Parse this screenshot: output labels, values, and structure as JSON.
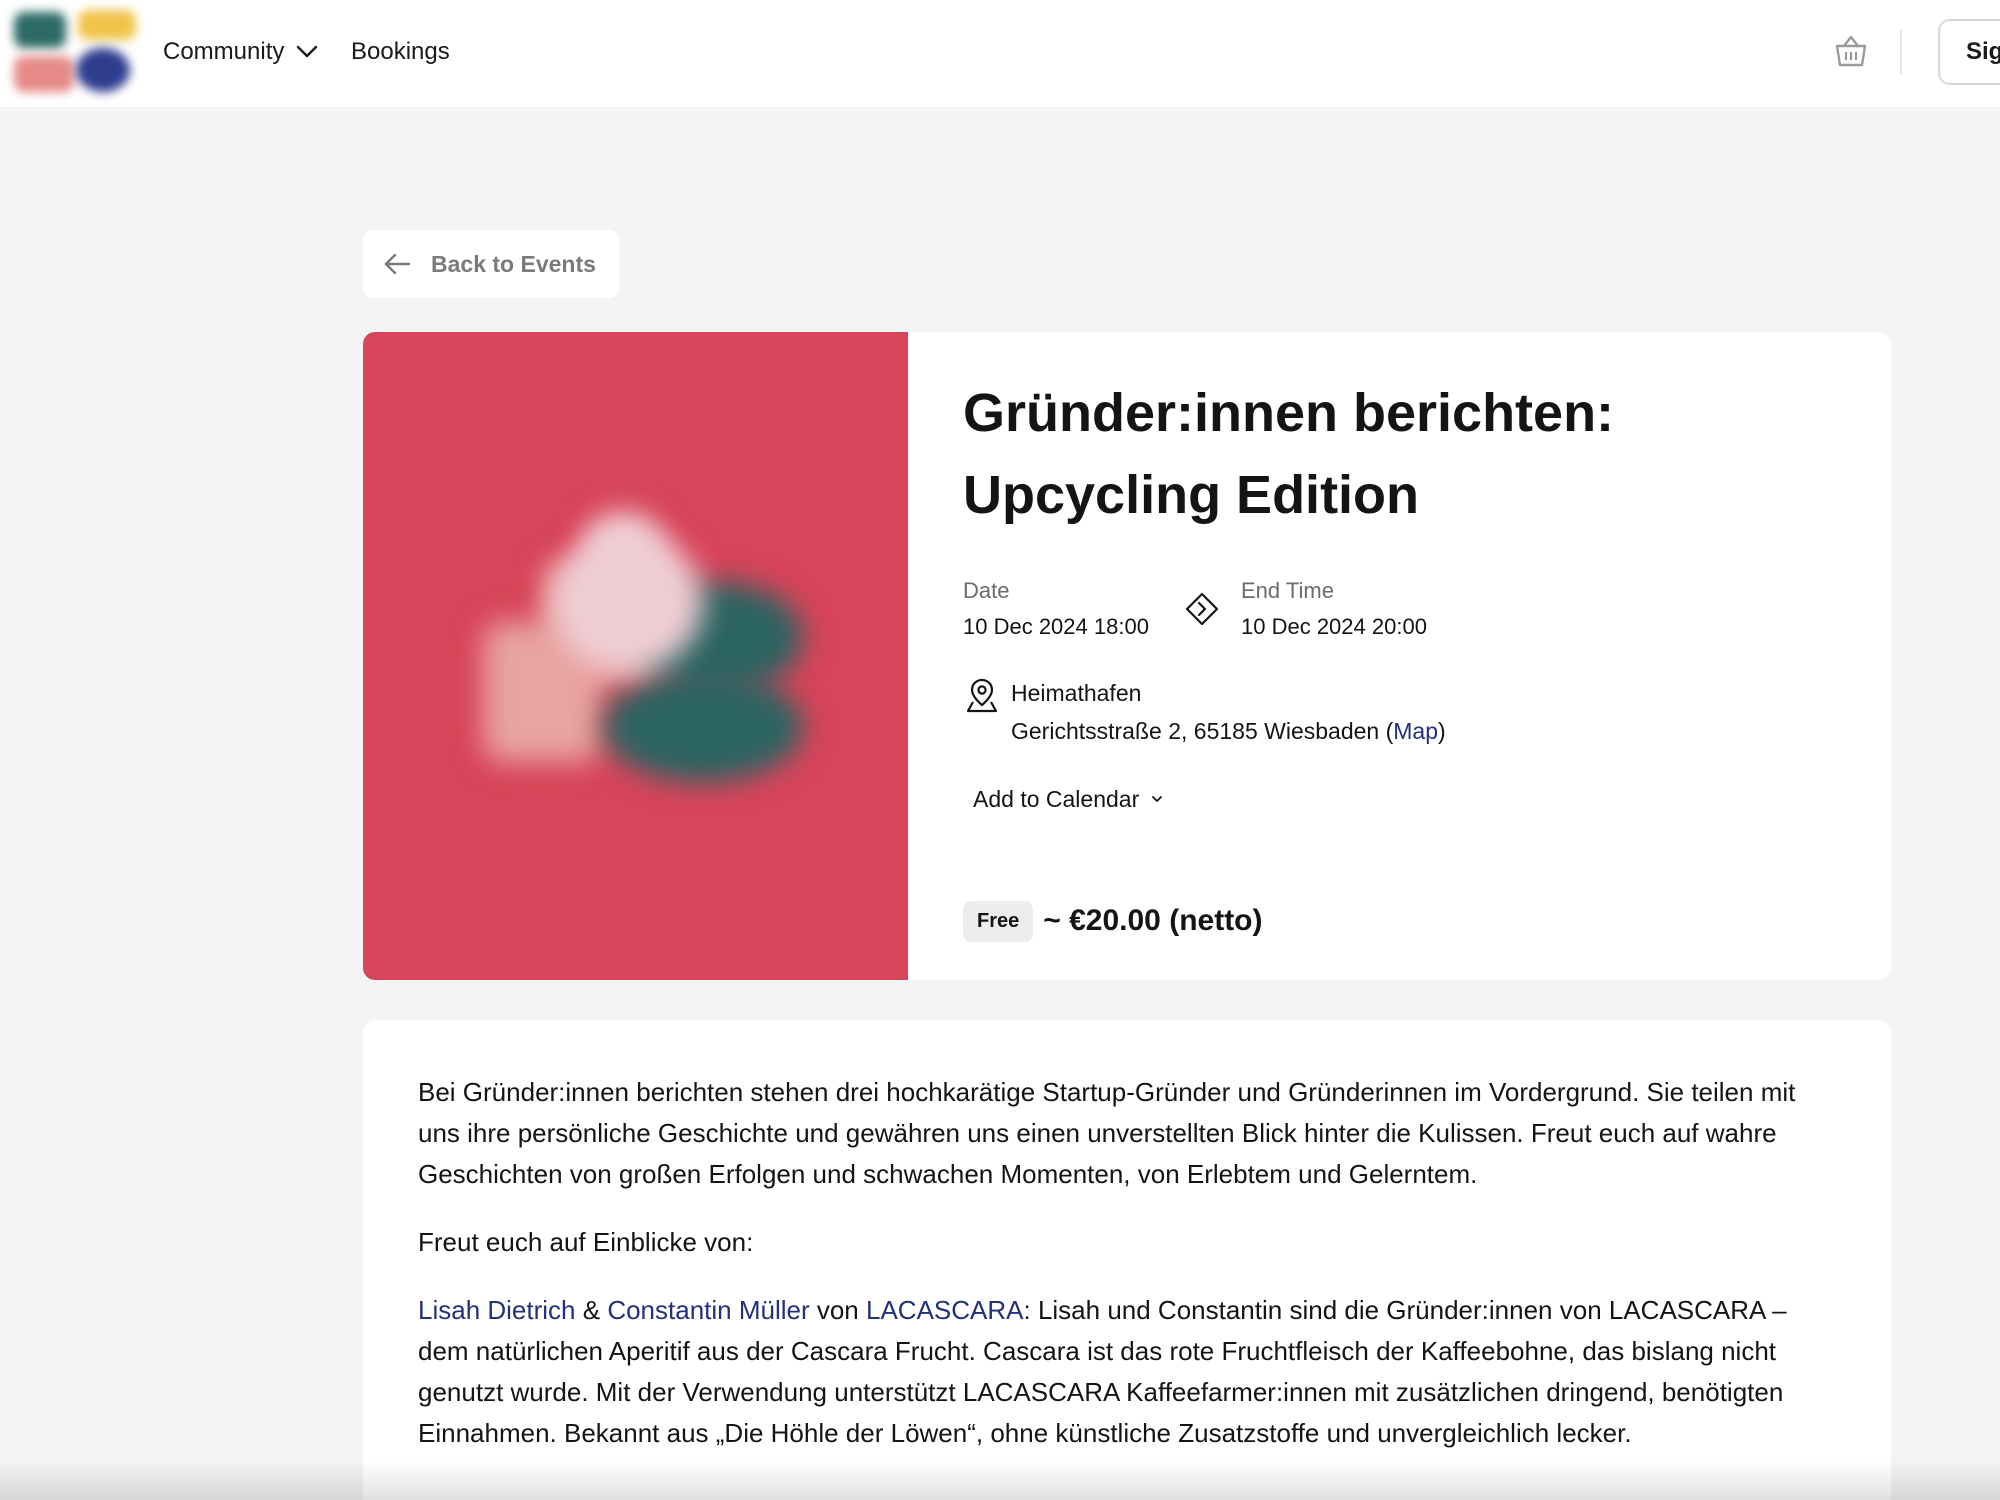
{
  "header": {
    "nav_community": "Community",
    "nav_bookings": "Bookings",
    "signin_label": "Sig",
    "logo_name": "logo",
    "cart_icon": "basket-icon",
    "chevron_icon": "chevron-down-icon"
  },
  "back_button": {
    "label": "Back to Events",
    "icon": "arrow-left-icon"
  },
  "event": {
    "title_line1": "Gründer:innen berichten:",
    "title_line2": "Upcycling Edition",
    "date_label": "Date",
    "date_value": "10 Dec 2024 18:00",
    "end_label": "End Time",
    "end_value": "10 Dec 2024 20:00",
    "arrow_icon": "arrow-right-circle-icon",
    "venue_icon": "location-pin-icon",
    "venue_name": "Heimathafen",
    "venue_address": "Gerichtsstraße 2, 65185 Wiesbaden (",
    "map_link": "Map",
    "map_close": ")",
    "add_calendar": "Add to Calendar",
    "free_badge": "Free",
    "price": "~ €20.00 (netto)",
    "image_bg_color": "#d84459"
  },
  "description": {
    "para1": "Bei Gründer:innen berichten stehen drei hochkarätige Startup-Gründer und Gründerinnen im Vordergrund. Sie teilen mit uns ihre persönliche Geschichte und gewähren uns einen unverstellten Blick hinter die Kulissen. Freut euch auf wahre Geschichten von großen Erfolgen und schwachen Momenten, von Erlebtem und Gelerntem.",
    "para2": "Freut euch auf Einblicke von:",
    "person1": "Lisah Dietrich",
    "amp": " & ",
    "person2": "Constantin Müller",
    "von": " von ",
    "company": "LACASCARA",
    "para3_rest": ": Lisah und Constantin sind die Gründer:innen von LACASCARA – dem natürlichen Aperitif aus der Cascara Frucht. Cascara ist das rote Fruchtfleisch der Kaffeebohne, das bislang nicht genutzt wurde. Mit der Verwendung unterstützt LACASCARA Kaffeefarmer:innen mit zusätzlichen dringend, benötigten Einnahmen. Bekannt aus „Die Höhle der Löwen“, ohne künstliche Zusatzstoffe und unvergleichlich lecker."
  },
  "colors": {
    "accent_link": "#23307a",
    "page_bg": "#f4f4f4",
    "image_red": "#d84459",
    "blob_teal": "#2b6462",
    "blob_pink": "#efcdd4"
  }
}
